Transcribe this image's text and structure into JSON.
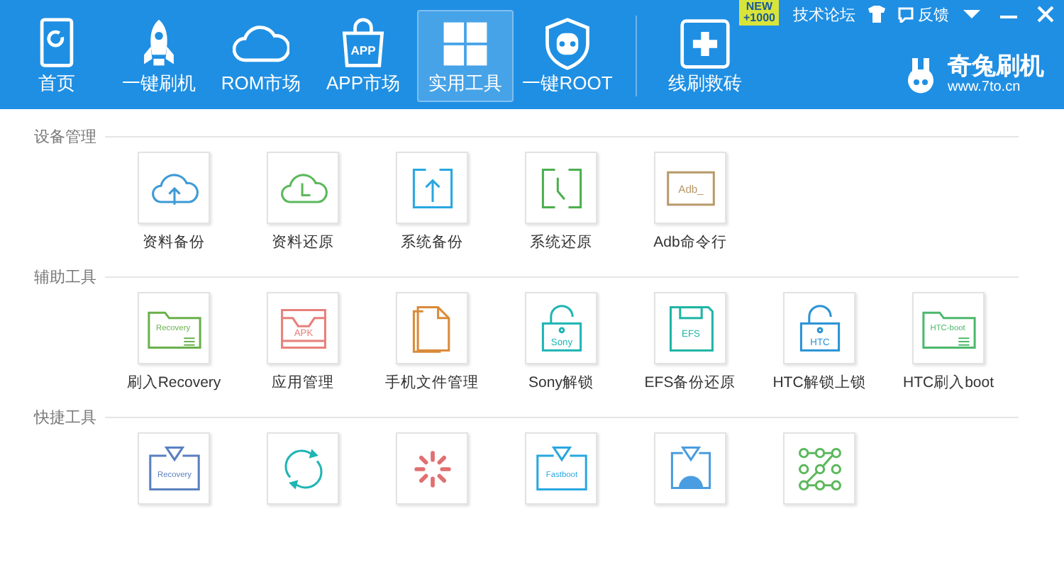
{
  "nav": [
    {
      "label": "首页",
      "kind": "home",
      "selected": false
    },
    {
      "label": "一键刷机",
      "kind": "rocket",
      "selected": false
    },
    {
      "label": "ROM市场",
      "kind": "cloud",
      "selected": false
    },
    {
      "label": "APP市场",
      "kind": "bag",
      "icon_text": "APP",
      "selected": false
    },
    {
      "label": "实用工具",
      "kind": "grid",
      "selected": true
    },
    {
      "label": "一键ROOT",
      "kind": "shield",
      "selected": false
    },
    {
      "label": "线刷救砖",
      "kind": "rescue",
      "selected": false,
      "badge": [
        "NEW",
        "+1000"
      ]
    }
  ],
  "top_links": {
    "forum": "技术论坛",
    "feedback": "反馈"
  },
  "logo": {
    "name": "奇兔刷机",
    "url": "www.7to.cn"
  },
  "sections": [
    {
      "title": "设备管理",
      "tools": [
        {
          "label": "资料备份",
          "kind": "cloud-up",
          "color": "#3d9ad6"
        },
        {
          "label": "资料还原",
          "kind": "cloud-clock",
          "color": "#5cb85c"
        },
        {
          "label": "系统备份",
          "kind": "box-up",
          "color": "#29a7e0"
        },
        {
          "label": "系统还原",
          "kind": "box-clock",
          "color": "#4caf50"
        },
        {
          "label": "Adb命令行",
          "kind": "terminal",
          "icon_text": "Adb_",
          "color": "#b89a6a"
        }
      ]
    },
    {
      "title": "辅助工具",
      "tools": [
        {
          "label": "刷入Recovery",
          "kind": "folder",
          "icon_text": "Recovery",
          "color": "#6ab04c"
        },
        {
          "label": "应用管理",
          "kind": "tray",
          "icon_text": "APK",
          "color": "#e8807a"
        },
        {
          "label": "手机文件管理",
          "kind": "file",
          "color": "#d98b3a"
        },
        {
          "label": "Sony解锁",
          "kind": "lock",
          "icon_text": "Sony",
          "color": "#1fb5b5"
        },
        {
          "label": "EFS备份还原",
          "kind": "floppy",
          "icon_text": "EFS",
          "color": "#1fb5a5"
        },
        {
          "label": "HTC解锁上锁",
          "kind": "lock",
          "icon_text": "HTC",
          "color": "#2a93d5"
        },
        {
          "label": "HTC刷入boot",
          "kind": "folder",
          "icon_text": "HTC-boot",
          "color": "#4cb86c"
        }
      ]
    },
    {
      "title": "快捷工具",
      "tools": [
        {
          "kind": "tray-down",
          "icon_text": "Recovery",
          "color": "#5a7fc0"
        },
        {
          "kind": "sync",
          "color": "#1fb5b5"
        },
        {
          "kind": "spinner",
          "color": "#e07070"
        },
        {
          "kind": "tray-down",
          "icon_text": "Fastboot",
          "color": "#29a7e0"
        },
        {
          "kind": "tray-android",
          "color": "#4a9de0"
        },
        {
          "kind": "pattern",
          "color": "#5cb85c"
        }
      ]
    }
  ]
}
